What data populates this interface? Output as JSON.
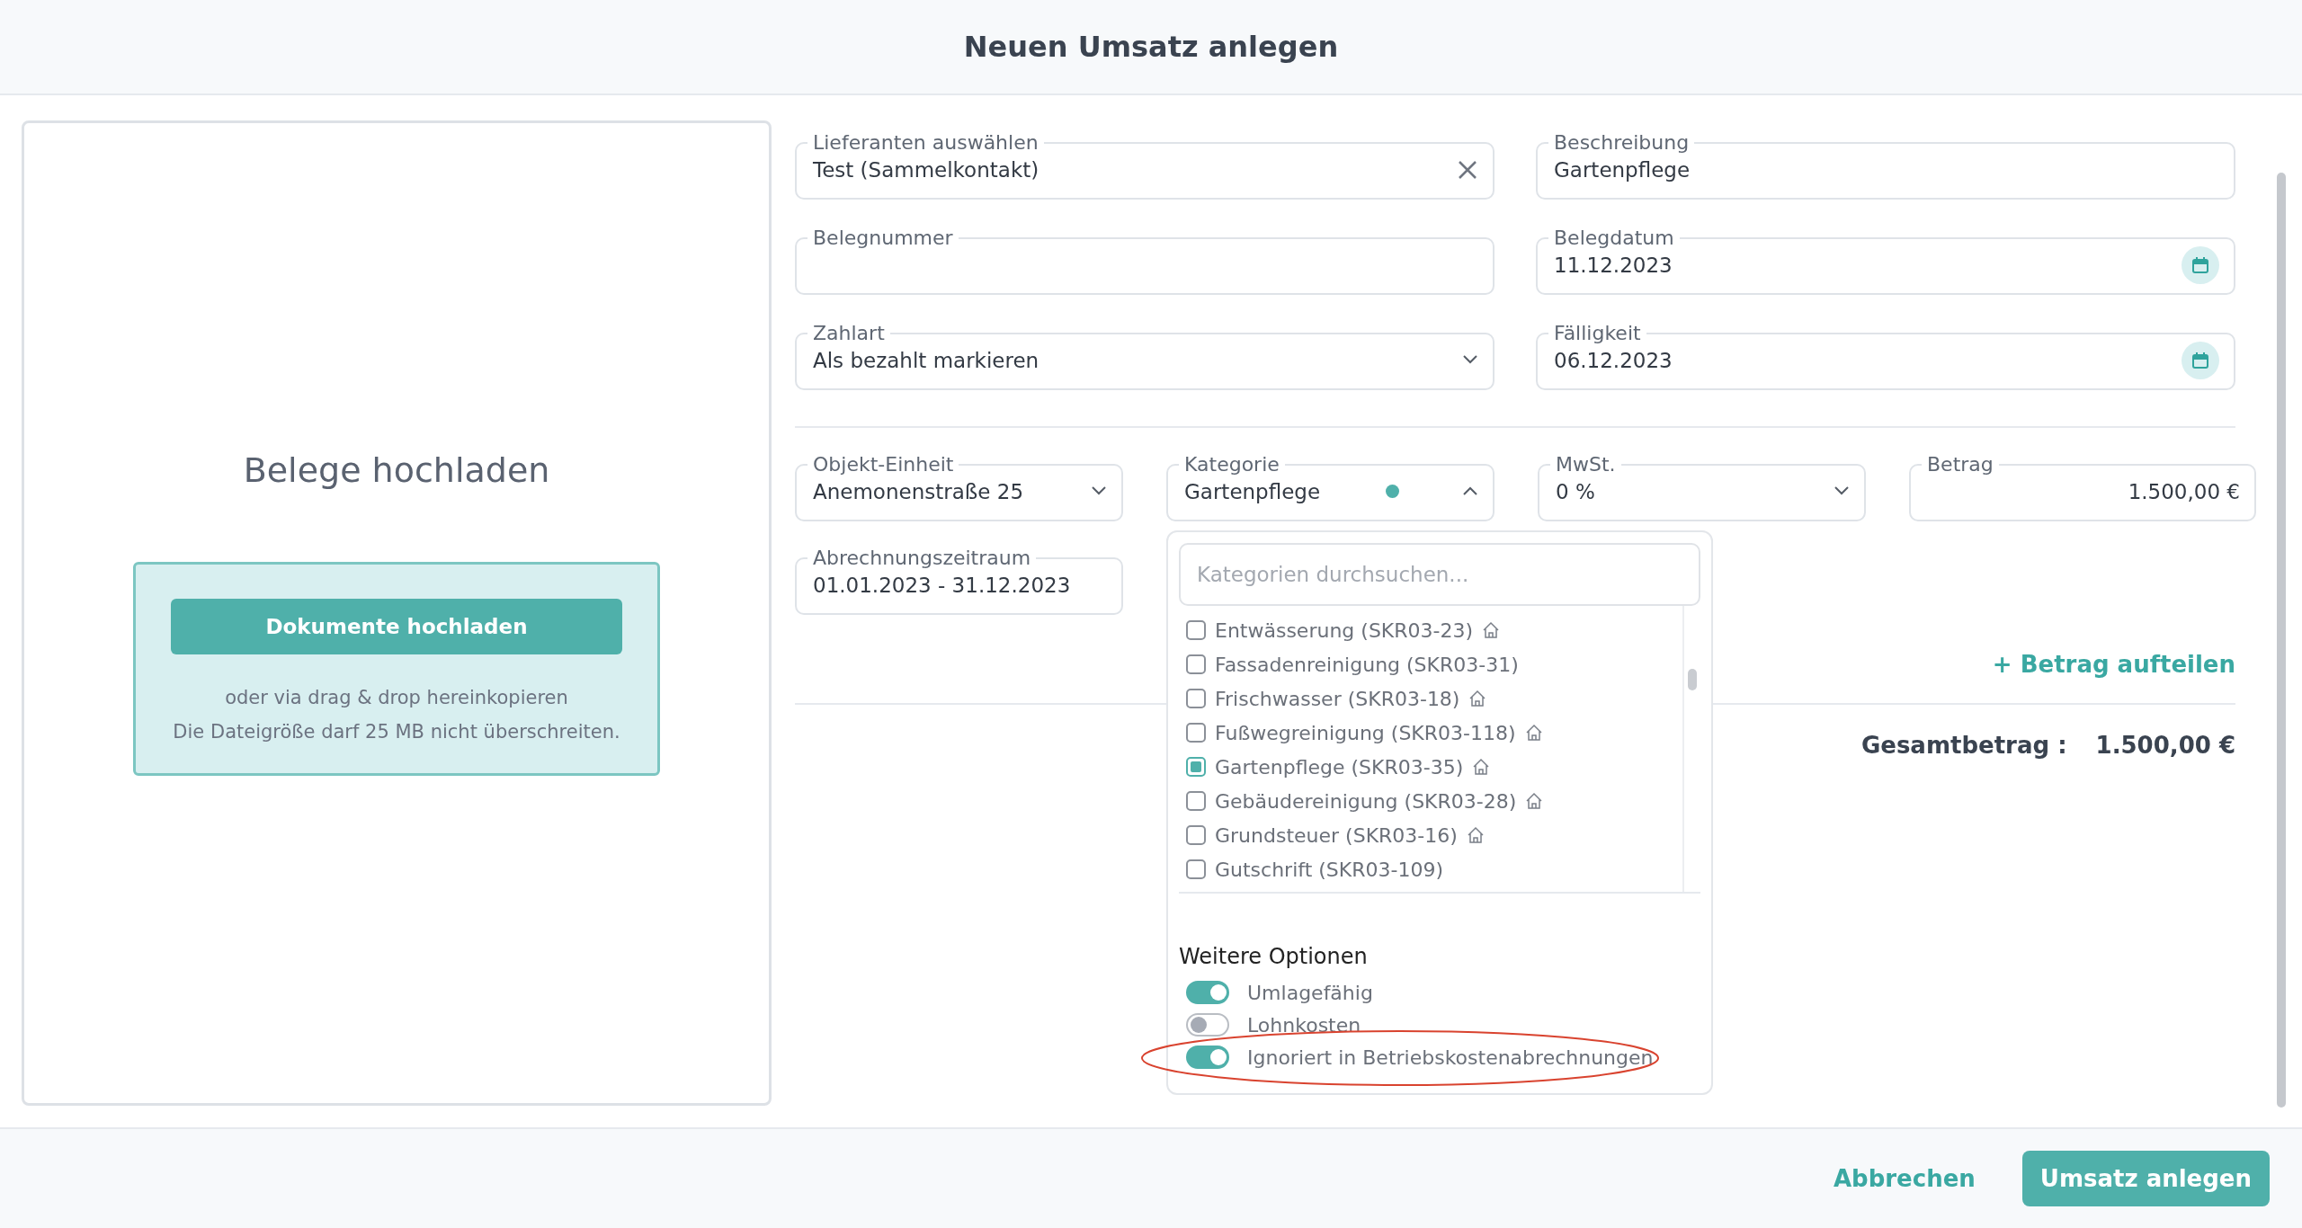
{
  "dialog": {
    "title": "Neuen Umsatz anlegen"
  },
  "upload": {
    "heading": "Belege hochladen",
    "button": "Dokumente hochladen",
    "hint_lines": [
      "oder via drag & drop hereinkopieren",
      "Die Dateigröße darf 25 MB nicht überschreiten."
    ]
  },
  "fields": [
    {
      "label": "Lieferanten auswählen",
      "value": "Test (Sammelkontakt)",
      "kind": "clearable"
    },
    {
      "label": "Beschreibung",
      "value": "Gartenpflege",
      "kind": "text"
    },
    {
      "label": "Belegnummer",
      "kind": "text"
    },
    {
      "label": "Belegdatum",
      "value": "11.12.2023",
      "kind": "date"
    },
    {
      "label": "Zahlart",
      "value": "Als bezahlt markieren",
      "kind": "select",
      "expanded": false
    },
    {
      "label": "Fälligkeit",
      "value": "06.12.2023",
      "kind": "date"
    }
  ],
  "details": [
    {
      "label": "Objekt-Einheit",
      "value": "Anemonenstraße 25",
      "kind": "select",
      "expanded": false
    },
    {
      "label": "Kategorie",
      "value": "Gartenpflege",
      "kind": "select",
      "expanded": true
    },
    {
      "label": "MwSt.",
      "value": "0 %",
      "kind": "select",
      "expanded": false
    },
    {
      "label": "Betrag",
      "value": "1.500,00 €",
      "kind": "amount"
    },
    {
      "label": "Abrechnungszeitraum",
      "value": "01.01.2023 - 31.12.2023",
      "kind": "text"
    }
  ],
  "split_link": "+ Betrag aufteilen",
  "total": {
    "label": "Gesamtbetrag :",
    "value": "1.500,00 €"
  },
  "category_dropdown": {
    "placeholder": "Kategorien durchsuchen...",
    "items": [
      {
        "label": "Entwässerung (SKR03-23)",
        "checked": false,
        "house": true
      },
      {
        "label": "Fassadenreinigung (SKR03-31)",
        "checked": false,
        "house": false
      },
      {
        "label": "Frischwasser (SKR03-18)",
        "checked": false,
        "house": true
      },
      {
        "label": "Fußwegreinigung (SKR03-118)",
        "checked": false,
        "house": true
      },
      {
        "label": "Gartenpflege (SKR03-35)",
        "checked": true,
        "house": true
      },
      {
        "label": "Gebäudereinigung (SKR03-28)",
        "checked": false,
        "house": true
      },
      {
        "label": "Grundsteuer (SKR03-16)",
        "checked": false,
        "house": true
      },
      {
        "label": "Gutschrift (SKR03-109)",
        "checked": false,
        "house": false
      }
    ],
    "options_heading": "Weitere Optionen",
    "options": [
      {
        "label": "Umlagefähig",
        "on": true,
        "highlighted": false
      },
      {
        "label": "Lohnkosten",
        "on": false,
        "highlighted": false
      },
      {
        "label": "Ignoriert in Betriebskostenabrechnungen",
        "on": true,
        "highlighted": true
      }
    ]
  },
  "footer": {
    "cancel": "Abbrechen",
    "submit": "Umsatz anlegen"
  }
}
